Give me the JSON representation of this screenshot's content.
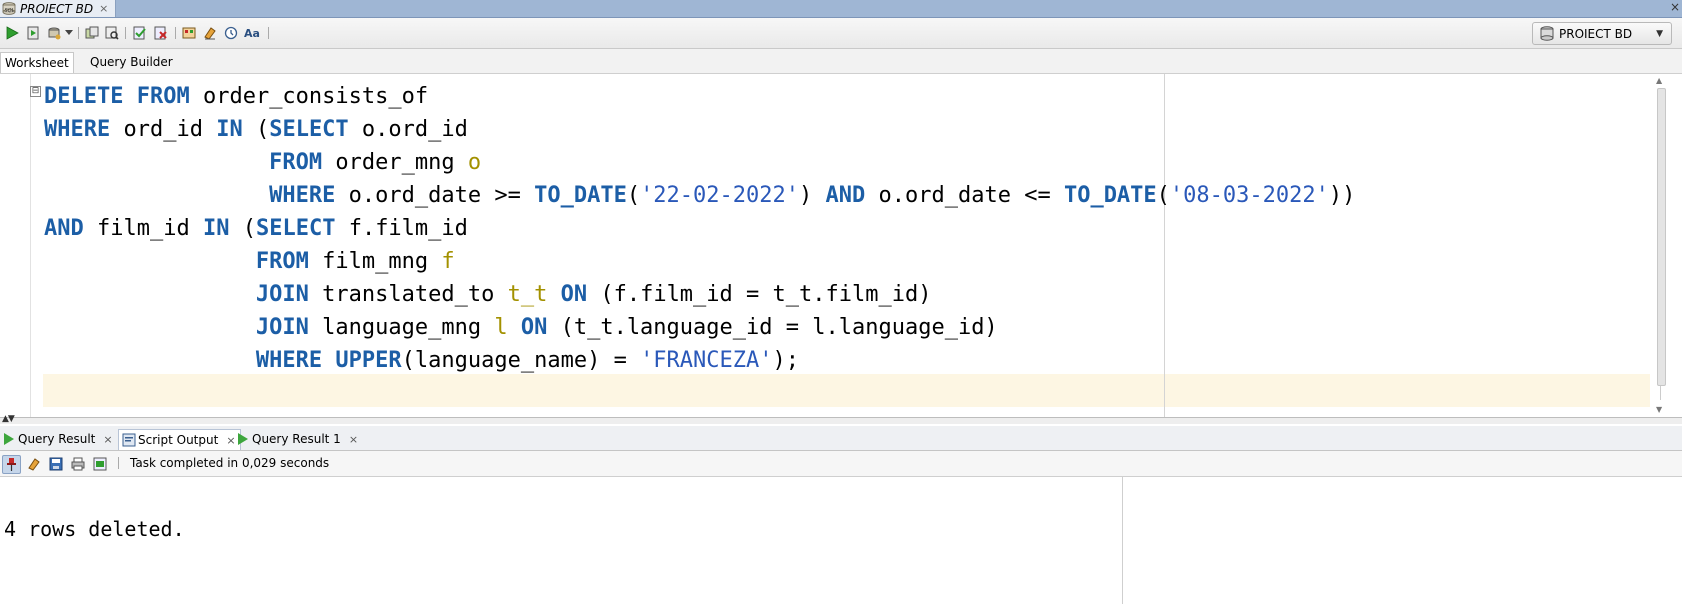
{
  "document_tab": {
    "title": "PROIECT BD",
    "close": "×"
  },
  "window": {
    "close": "×"
  },
  "connection": {
    "name": "PROIECT BD",
    "chevron": "▼"
  },
  "tabs": {
    "worksheet": "Worksheet",
    "query_builder": "Query Builder"
  },
  "editor": {
    "fold_glyph": "⊟",
    "lines": [
      [
        [
          "kw",
          "DELETE"
        ],
        [
          "t",
          " "
        ],
        [
          "kw",
          "FROM"
        ],
        [
          "t",
          " order_consists_of"
        ]
      ],
      [
        [
          "kw",
          "WHERE"
        ],
        [
          "t",
          " ord_id "
        ],
        [
          "kw",
          "IN"
        ],
        [
          "t",
          " ("
        ],
        [
          "kw",
          "SELECT"
        ],
        [
          "t",
          " o.ord_id"
        ]
      ],
      [
        [
          "t",
          "                 "
        ],
        [
          "kw",
          "FROM"
        ],
        [
          "t",
          " order_mng "
        ],
        [
          "a",
          "o"
        ]
      ],
      [
        [
          "t",
          "                 "
        ],
        [
          "kw",
          "WHERE"
        ],
        [
          "t",
          " o.ord_date >= "
        ],
        [
          "kw",
          "TO_DATE"
        ],
        [
          "t",
          "("
        ],
        [
          "s",
          "'22-02-2022'"
        ],
        [
          "t",
          ") "
        ],
        [
          "kw",
          "AND"
        ],
        [
          "t",
          " o.ord_date <= "
        ],
        [
          "kw",
          "TO_DATE"
        ],
        [
          "t",
          "("
        ],
        [
          "s",
          "'08-03-2022'"
        ],
        [
          "t",
          "))"
        ]
      ],
      [
        [
          "kw",
          "AND"
        ],
        [
          "t",
          " film_id "
        ],
        [
          "kw",
          "IN"
        ],
        [
          "t",
          " ("
        ],
        [
          "kw",
          "SELECT"
        ],
        [
          "t",
          " f.film_id"
        ]
      ],
      [
        [
          "t",
          "                "
        ],
        [
          "kw",
          "FROM"
        ],
        [
          "t",
          " film_mng "
        ],
        [
          "a",
          "f"
        ]
      ],
      [
        [
          "t",
          "                "
        ],
        [
          "kw",
          "JOIN"
        ],
        [
          "t",
          " translated_to "
        ],
        [
          "a",
          "t_t"
        ],
        [
          "t",
          " "
        ],
        [
          "kw",
          "ON"
        ],
        [
          "t",
          " (f.film_id = t_t.film_id)"
        ]
      ],
      [
        [
          "t",
          "                "
        ],
        [
          "kw",
          "JOIN"
        ],
        [
          "t",
          " language_mng "
        ],
        [
          "a",
          "l"
        ],
        [
          "t",
          " "
        ],
        [
          "kw",
          "ON"
        ],
        [
          "t",
          " (t_t.language_id = l.language_id)"
        ]
      ],
      [
        [
          "t",
          "                "
        ],
        [
          "kw",
          "WHERE"
        ],
        [
          "t",
          " "
        ],
        [
          "kw",
          "UPPER"
        ],
        [
          "t",
          "(language_name) = "
        ],
        [
          "s",
          "'FRANCEZA'"
        ],
        [
          "t",
          ");"
        ]
      ],
      [
        [
          "t",
          ""
        ]
      ]
    ]
  },
  "output_tabs": [
    {
      "label": "Query Result",
      "close": "×",
      "icon": "play-icon"
    },
    {
      "label": "Script Output",
      "close": "×",
      "icon": "script-icon"
    },
    {
      "label": "Query Result 1",
      "close": "×",
      "icon": "play-icon"
    }
  ],
  "output_toolbar": {
    "status": "Task completed in 0,029 seconds"
  },
  "output": {
    "text": "4 rows deleted."
  },
  "colors": {
    "keyword": "#1c5ea6",
    "string": "#2a58b9",
    "alias": "#a39100",
    "current_line": "#fdf6e3"
  }
}
